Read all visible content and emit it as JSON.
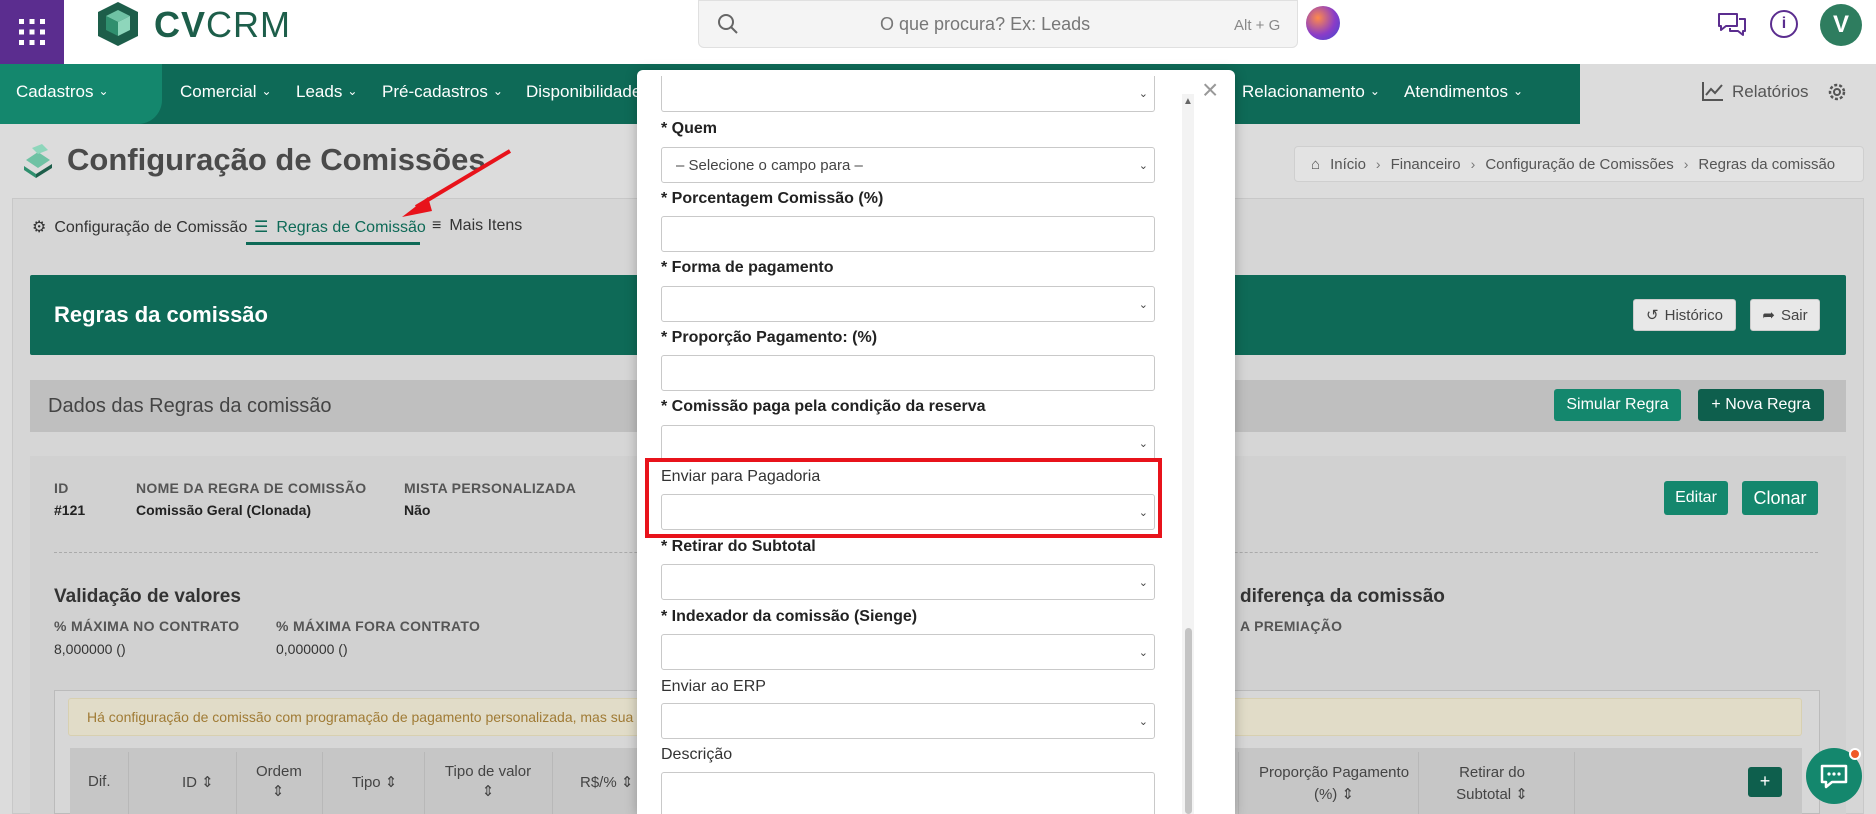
{
  "header": {
    "logo_text_bold": "CV",
    "logo_text_light": "CRM",
    "search_placeholder": "O que procura? Ex: Leads",
    "search_shortcut": "Alt + G",
    "avatar_initial": "V"
  },
  "nav": {
    "items": [
      "Cadastros",
      "Comercial",
      "Leads",
      "Pré-cadastros",
      "Disponibilidade",
      "Relacionamento",
      "Atendimentos"
    ],
    "relatorios": "Relatórios"
  },
  "page": {
    "title": "Configuração de Comissões",
    "breadcrumb": [
      "Início",
      "Financeiro",
      "Configuração de Comissões",
      "Regras da comissão"
    ],
    "tabs": [
      "Configuração de Comissão",
      "Regras de Comissão",
      "Mais Itens"
    ],
    "banner_title": "Regras da comissão",
    "btn_historico": "Histórico",
    "btn_sair": "Sair",
    "section_title": "Dados das Regras da comissão",
    "btn_simular": "Simular Regra",
    "btn_nova": "+ Nova Regra",
    "btn_editar": "Editar",
    "btn_clonar": "Clonar"
  },
  "details": {
    "id_label": "ID",
    "id_value": "#121",
    "nome_label": "NOME DA REGRA DE COMISSÃO",
    "nome_value": "Comissão Geral (Clonada)",
    "mista_label": "MISTA PERSONALIZADA",
    "mista_value": "Não",
    "validacao_title": "Validação de valores",
    "max_contrato_label": "% MÁXIMA NO CONTRATO",
    "max_contrato_value": "8,000000 ()",
    "max_fora_label": "% MÁXIMA FORA CONTRATO",
    "max_fora_value": "0,000000 ()",
    "diferenca_title": "diferença da comissão",
    "premiacao_label": "A PREMIAÇÃO",
    "warning": "Há configuração de comissão com programação de pagamento personalizada, mas sua"
  },
  "table": {
    "headers": [
      "Dif.",
      "ID",
      "Ordem",
      "Tipo",
      "Tipo de valor",
      "R$/%",
      "Proporção Pagamento (%)",
      "Retirar do Subtotal"
    ],
    "add_button": "+"
  },
  "modal": {
    "fields": [
      {
        "label": "* Quem",
        "value": "– Selecione o campo para –",
        "type": "select"
      },
      {
        "label": "* Porcentagem Comissão (%)",
        "value": "",
        "type": "input"
      },
      {
        "label": "* Forma de pagamento",
        "value": "",
        "type": "select"
      },
      {
        "label": "* Proporção Pagamento: (%)",
        "value": "",
        "type": "input"
      },
      {
        "label": "* Comissão paga pela condição da reserva",
        "value": "",
        "type": "select"
      },
      {
        "label": "Enviar para Pagadoria",
        "value": "",
        "type": "select"
      },
      {
        "label": "* Retirar do Subtotal",
        "value": "",
        "type": "select"
      },
      {
        "label": "* Indexador da comissão (Sienge)",
        "value": "",
        "type": "select"
      },
      {
        "label": "Enviar ao ERP",
        "value": "",
        "type": "select"
      },
      {
        "label": "Descrição",
        "value": "",
        "type": "textarea"
      }
    ]
  },
  "colors": {
    "brand_green": "#0e6a57",
    "accent_green": "#14876d",
    "apps_purple": "#5b2d8f",
    "highlight_red": "#e8131b"
  }
}
